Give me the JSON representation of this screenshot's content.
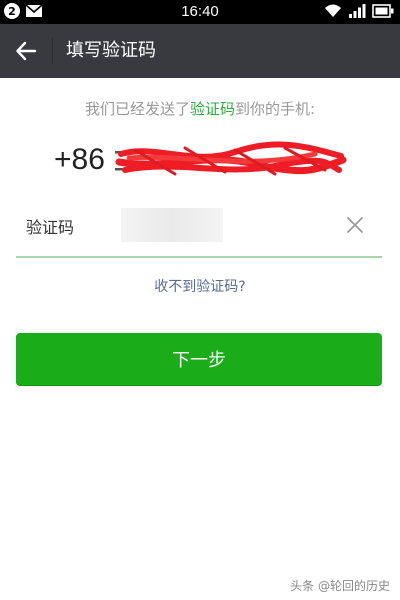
{
  "status_bar": {
    "notification_count": "2",
    "time": "16:40",
    "icons": [
      "mail-icon",
      "wifi-icon",
      "signal-icon",
      "battery-icon"
    ]
  },
  "app_bar": {
    "back_icon": "arrow-left-icon",
    "title": "填写验证码"
  },
  "hint": {
    "prefix": "我们已经发送了",
    "highlight": "验证码",
    "suffix": "到你的手机:"
  },
  "phone": {
    "country_code": "+86",
    "number": ""
  },
  "code_field": {
    "label": "验证码",
    "value": "",
    "placeholder": ""
  },
  "resend_link": "收不到验证码?",
  "next_button": "下一步",
  "watermark": "头条 @轮回的历史",
  "colors": {
    "app_bar": "#393a3f",
    "accent_green": "#1aad19",
    "link_blue": "#576b95",
    "highlight_green": "#2bae3e",
    "redaction_red": "#ee1c25"
  }
}
